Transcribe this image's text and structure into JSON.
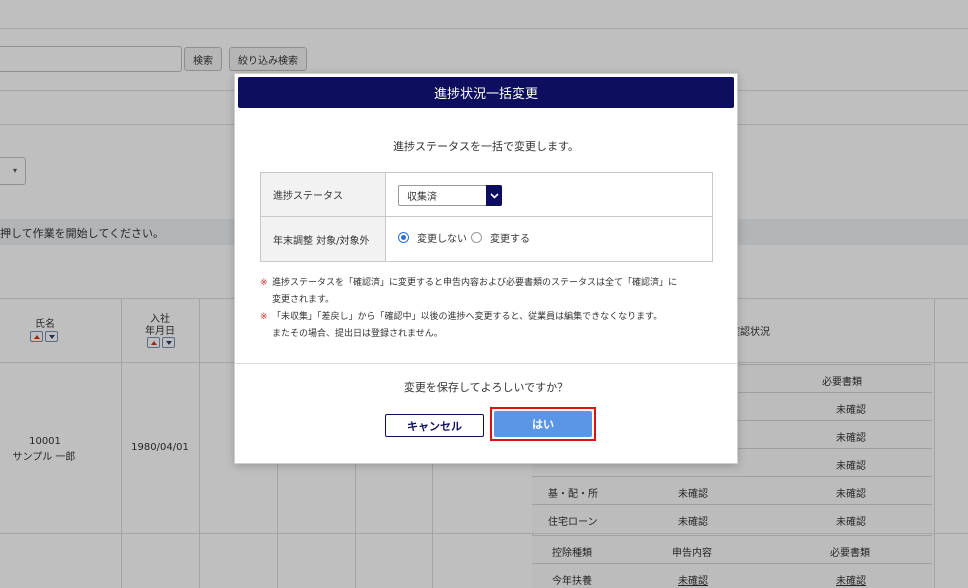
{
  "background": {
    "search_button": "検索",
    "filter_search_button": "絞り込み検索",
    "info_text": "押して作業を開始してください。",
    "columns": {
      "name": "氏名",
      "joined_line1": "入社",
      "joined_line2": "年月日",
      "confirm_status": "確認状況"
    },
    "employee": {
      "id": "10001",
      "name": "サンプル 一郎",
      "joined": "1980/04/01"
    },
    "subtable": {
      "header_required_docs": "必要書類",
      "rows": [
        {
          "type": "",
          "declaration": "",
          "docs": "未確認"
        },
        {
          "type": "",
          "declaration": "",
          "docs": "未確認"
        },
        {
          "type": "",
          "declaration": "",
          "docs": "未確認"
        },
        {
          "type": "基・配・所",
          "declaration": "未確認",
          "docs": "未確認"
        },
        {
          "type": "住宅ローン",
          "declaration": "未確認",
          "docs": "未確認"
        }
      ],
      "second_header": {
        "type": "控除種類",
        "declaration": "申告内容",
        "docs": "必要書類"
      },
      "second_row": {
        "type": "今年扶養",
        "declaration": "未確認",
        "docs": "未確認"
      }
    }
  },
  "modal": {
    "title": "進捗状況一括変更",
    "description": "進捗ステータスを一括で変更します。",
    "status_label": "進捗ステータス",
    "status_value": "収集済",
    "year_end_label": "年末調整 対象/対象外",
    "radio_no_change": "変更しない",
    "radio_change": "変更する",
    "note_mark": "※",
    "note1_line1": "進捗ステータスを「確認済」に変更すると申告内容および必要書類のステータスは全て「確認済」に",
    "note1_line2": "変更されます。",
    "note2_line1": "「未収集」「差戻し」から「確認中」以後の進捗へ変更すると、従業員は編集できなくなります。",
    "note2_line2": "またその場合、提出日は登録されません。",
    "confirm_question": "変更を保存してよろしいですか？",
    "cancel_label": "キャンセル",
    "yes_label": "はい"
  },
  "colors": {
    "header_navy": "#0d0f5e",
    "primary_blue": "#5b95e6",
    "highlight_red": "#e01010",
    "note_red": "#d0312d"
  }
}
